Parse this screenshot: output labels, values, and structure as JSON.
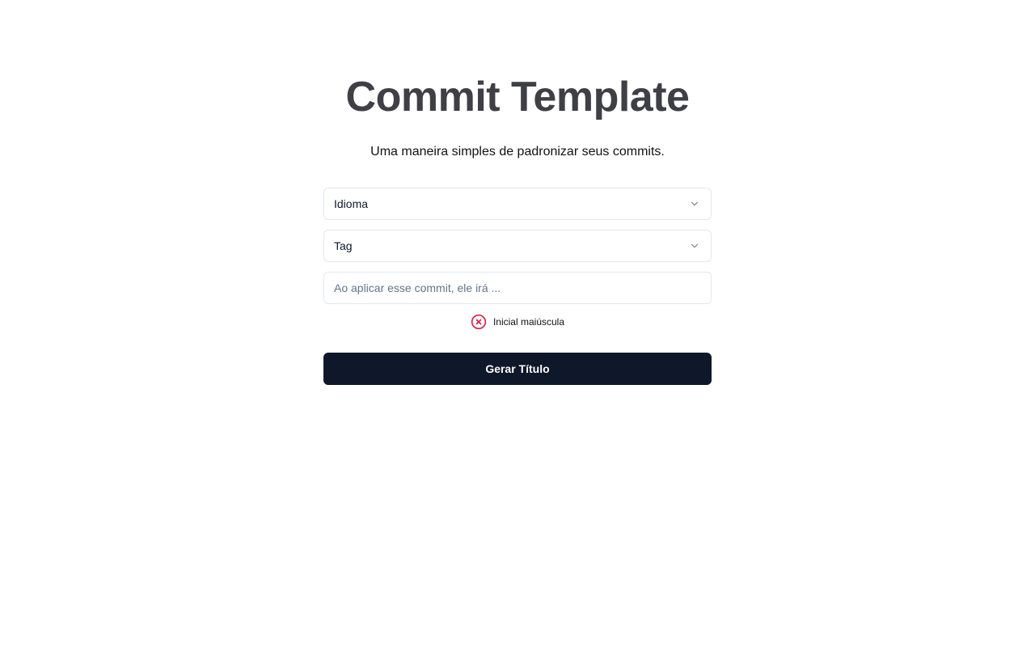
{
  "header": {
    "title": "Commit Template",
    "subtitle": "Uma maneira simples de padronizar seus commits."
  },
  "form": {
    "language_select": {
      "label": "Idioma",
      "icon": "chevron-down-icon"
    },
    "tag_select": {
      "label": "Tag",
      "icon": "chevron-down-icon"
    },
    "commit_input": {
      "value": "",
      "placeholder": "Ao aplicar esse commit, ele irá ..."
    },
    "validation": {
      "icon": "x-circle-icon",
      "text": "Inicial maiúscula",
      "color": "#e11d48"
    },
    "submit_label": "Gerar Título"
  },
  "colors": {
    "title": "#3f3f46",
    "button_bg": "#0f172a",
    "border": "#e2e8f0",
    "placeholder": "#64748b"
  }
}
